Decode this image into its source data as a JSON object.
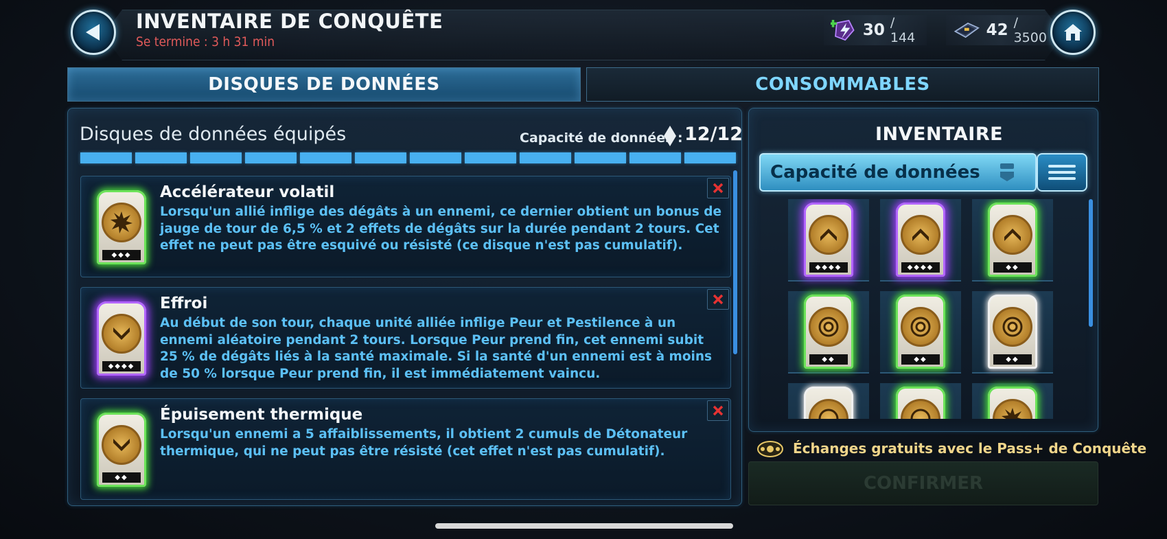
{
  "header": {
    "title": "INVENTAIRE DE CONQUÊTE",
    "subtitle": "Se termine : 3 h 31 min",
    "energy": {
      "value": "30",
      "max": "/ 144",
      "icon": "energy-icon"
    },
    "credits": {
      "value": "42",
      "max": "/ 3500",
      "icon": "keycard-icon"
    }
  },
  "tabs": [
    {
      "label": "DISQUES DE DONNÉES",
      "active": true
    },
    {
      "label": "CONSOMMABLES",
      "active": false
    }
  ],
  "equipped": {
    "title": "Disques de données équipés",
    "capacity_label": "Capacité de données :",
    "capacity_value": "12/12",
    "segments_filled": 12,
    "segments_total": 12,
    "cards": [
      {
        "name": "Accélérateur volatil",
        "description": "Lorsqu'un allié inflige des dégâts à un ennemi, ce dernier obtient un bonus de jauge de tour de 6,5 % et 2 effets de dégâts sur la durée pendant 2 tours. Cet effet ne peut pas être esquivé ou résisté (ce disque n'est pas cumulatif).",
        "rarity": "green",
        "pips": "◆◆◆"
      },
      {
        "name": "Effroi",
        "description": "Au début de son tour, chaque unité alliée inflige Peur et Pestilence à un ennemi aléatoire pendant 2 tours. Lorsque Peur prend fin, cet ennemi subit 25 % de dégâts liés à la santé maximale. Si la santé d'un ennemi est à moins de 50 % lorsque Peur prend fin, il est immédiatement vaincu.",
        "rarity": "purple",
        "pips": "◆◆◆◆"
      },
      {
        "name": "Épuisement thermique",
        "description": "Lorsqu'un ennemi a 5 affaiblissements, il obtient 2 cumuls de Détonateur thermique, qui ne peut pas être résisté (cet effet n'est pas cumulatif).",
        "rarity": "green",
        "pips": "◆◆"
      }
    ]
  },
  "inventory": {
    "title": "INVENTAIRE",
    "sort_value": "Capacité de données",
    "items": [
      {
        "rarity": "purple",
        "emblem": "chevron-up",
        "pips": "◆◆◆◆"
      },
      {
        "rarity": "purple",
        "emblem": "chevron-up",
        "pips": "◆◆◆◆"
      },
      {
        "rarity": "green",
        "emblem": "chevron-up",
        "pips": "◆◆"
      },
      {
        "rarity": "green",
        "emblem": "target",
        "pips": "◆◆"
      },
      {
        "rarity": "green",
        "emblem": "target",
        "pips": "◆◆"
      },
      {
        "rarity": "white",
        "emblem": "target",
        "pips": "◆◆"
      },
      {
        "rarity": "white",
        "emblem": "target",
        "pips": ""
      },
      {
        "rarity": "green",
        "emblem": "target",
        "pips": ""
      },
      {
        "rarity": "green",
        "emblem": "burst",
        "pips": ""
      }
    ]
  },
  "pass_text": "Échanges gratuits avec le Pass+ de Conquête",
  "confirm_label": "CONFIRMER"
}
